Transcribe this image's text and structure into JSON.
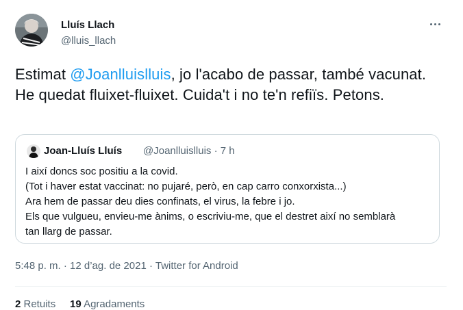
{
  "tweet": {
    "author": {
      "name": "Lluís Llach",
      "handle": "@lluis_llach"
    },
    "more_icon": "more-horizontal-icon",
    "text_before": "Estimat ",
    "mention": "@Joanlluislluis",
    "text_after": ", jo l'acabo de passar, també vacunat. He quedat fluixet-fluixet. Cuida't i no te'n refiïs. Petons.",
    "quote": {
      "name": "Joan-Lluís Lluís",
      "handle": "@Joanlluislluis · 7 h",
      "lines": [
        "I així doncs soc positiu a la covid.",
        "(Tot i haver estat vaccinat: no pujaré, però, en cap carro conxorxista...)",
        "Ara hem de passar deu dies confinats, el virus, la febre i jo.",
        "Els que vulgueu, envieu-me ànims, o escriviu-me, que el destret així no semblarà",
        "tan llarg de passar."
      ]
    },
    "timestamp": "5:48 p. m. · 12 d’ag. de 2021 · ",
    "source": "Twitter for Android",
    "stats": {
      "retweets": "2",
      "retweets_label": " Retuits",
      "likes": "19",
      "likes_label": " Agradaments"
    }
  },
  "colors": {
    "accent": "#1d9bf0",
    "secondary_text": "#536471",
    "border": "#cfd9de"
  }
}
